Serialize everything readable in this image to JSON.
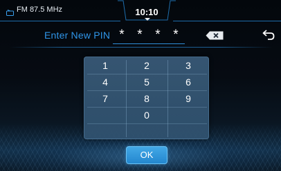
{
  "status_bar": {
    "radio_text": "FM 87.5 MHz",
    "radio_icon": "radio-icon",
    "clock": "10:10"
  },
  "pin_entry": {
    "label": "Enter New PIN",
    "masked_digits": [
      "*",
      "*",
      "*",
      "*"
    ],
    "delete_icon": "backspace-icon",
    "back_icon": "back-arrow-icon"
  },
  "keypad": {
    "keys": [
      "1",
      "2",
      "3",
      "4",
      "5",
      "6",
      "7",
      "8",
      "9",
      "0"
    ]
  },
  "ok_button": {
    "label": "OK"
  },
  "colors": {
    "accent": "#2f95e8",
    "keypad_bg": "#3a5c7a",
    "ok_bg": "#2a90d8"
  }
}
